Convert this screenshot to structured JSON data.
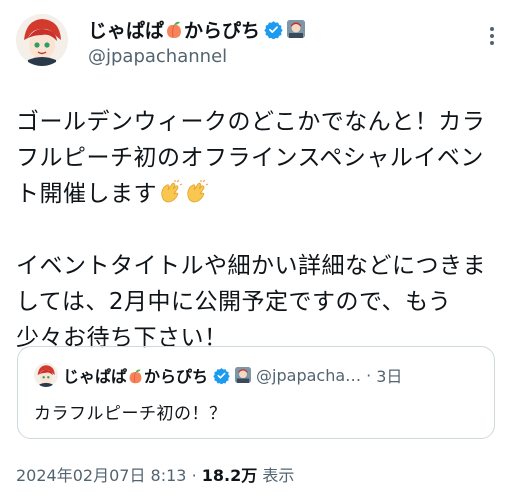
{
  "author": {
    "display_name_part1": "じゃぱぱ",
    "display_name_part2": "からぴち",
    "handle": "@jpapachannel"
  },
  "tweet": {
    "paragraph1": "ゴールデンウィークのどこかでなんと！カラフルピーチ初のオフラインスペシャルイベント開催します",
    "paragraph2": "イベントタイトルや細かい詳細などにつきましては、2月中に公開予定ですので、もう少々お待ち下さい！"
  },
  "quoted_tweet": {
    "display_name_part1": "じゃぱぱ",
    "display_name_part2": "からぴち",
    "handle": "@jpapacha…",
    "separator": "·",
    "time": "3日",
    "text": "カラフルピーチ初の！？"
  },
  "footer": {
    "timestamp": "2024年02月07日 8:13",
    "separator": "·",
    "views_count": "18.2万",
    "views_label": "表示"
  },
  "colors": {
    "verified": "#1d9bf0",
    "text_primary": "#0f1419",
    "text_secondary": "#536471",
    "border": "#cfd9de"
  }
}
